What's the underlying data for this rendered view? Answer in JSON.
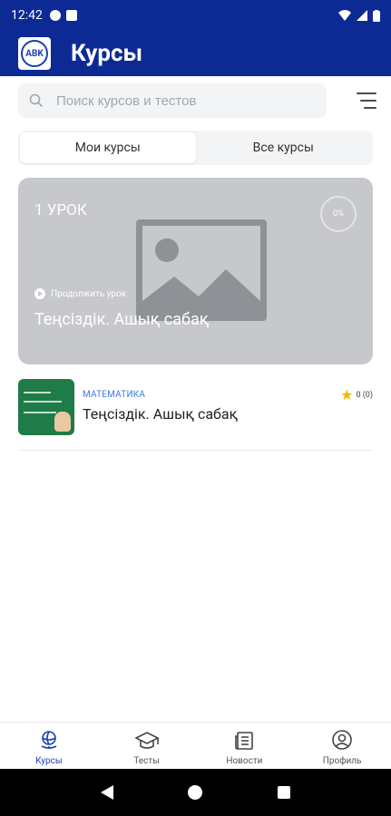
{
  "status": {
    "time": "12:42"
  },
  "appbar": {
    "title": "Курсы",
    "logo_text": "ABK"
  },
  "search": {
    "placeholder": "Поиск курсов и тестов"
  },
  "tabs": [
    {
      "label": "Мои курсы",
      "active": true
    },
    {
      "label": "Все курсы",
      "active": false
    }
  ],
  "hero": {
    "lessons": "1 УРОК",
    "progress": "0%",
    "continue_label": "Продолжить урок",
    "course_title": "Теңсіздік. Ашық сабақ"
  },
  "courses": [
    {
      "category": "МАТЕМАТИКА",
      "title": "Теңсіздік. Ашық сабақ",
      "rating": "0 (0)"
    }
  ],
  "bottom_nav": [
    {
      "label": "Курсы",
      "icon": "globe-icon",
      "active": true
    },
    {
      "label": "Тесты",
      "icon": "graduation-cap-icon",
      "active": false
    },
    {
      "label": "Новости",
      "icon": "newspaper-icon",
      "active": false
    },
    {
      "label": "Профиль",
      "icon": "user-circle-icon",
      "active": false
    }
  ],
  "colors": {
    "primary": "#0d2a94",
    "accent": "#1b3fb3",
    "category": "#3b7ce0",
    "star": "#f2b705"
  }
}
